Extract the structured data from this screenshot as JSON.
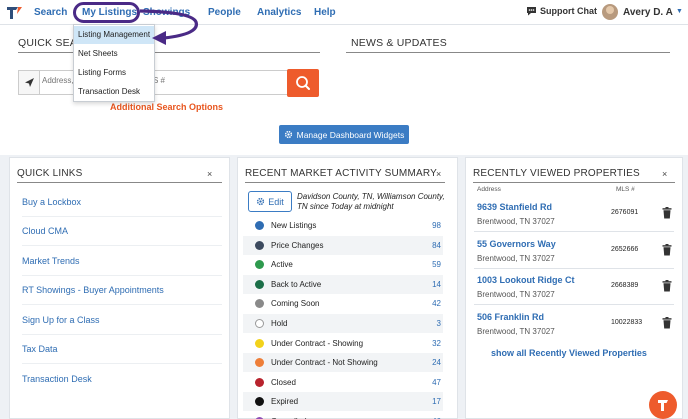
{
  "nav": {
    "items": [
      "Search",
      "My Listings",
      "Showings",
      "People",
      "Analytics",
      "Help"
    ],
    "support_chat": "Support Chat",
    "user_name": "Avery D. A"
  },
  "dropdown": {
    "items": [
      "Listing Management",
      "Net Sheets",
      "Listing Forms",
      "Transaction Desk"
    ],
    "active_index": 0
  },
  "quick_search": {
    "title": "QUICK SEA",
    "placeholder": "Address, City, Street, Zip or MLS #",
    "advanced_label": "Additional Search Options"
  },
  "news": {
    "title": "NEWS & UPDATES"
  },
  "manage_button": "Manage Dashboard Widgets",
  "quick_links": {
    "title": "QUICK LINKS",
    "close": "×",
    "items": [
      "Buy a Lockbox",
      "Cloud CMA",
      "Market Trends",
      "RT Showings - Buyer Appointments",
      "Sign Up for a Class",
      "Tax Data",
      "Transaction Desk"
    ]
  },
  "market_activity": {
    "title": "RECENT MARKET ACTIVITY SUMMARY",
    "close": "×",
    "edit_label": "Edit",
    "description": "Davidson County, TN, Williamson County, TN since Today at midnight",
    "rows": [
      {
        "label": "New Listings",
        "count": "98",
        "color": "#2f6db3"
      },
      {
        "label": "Price Changes",
        "count": "84",
        "color": "#3c4a5e"
      },
      {
        "label": "Active",
        "count": "59",
        "color": "#2e9a4e"
      },
      {
        "label": "Back to Active",
        "count": "14",
        "color": "#1b6e48"
      },
      {
        "label": "Coming Soon",
        "count": "42",
        "color": "#8a8a8a"
      },
      {
        "label": "Hold",
        "count": "3",
        "color": "#ffffff"
      },
      {
        "label": "Under Contract - Showing",
        "count": "32",
        "color": "#f2d21b"
      },
      {
        "label": "Under Contract - Not Showing",
        "count": "24",
        "color": "#ee7e38"
      },
      {
        "label": "Closed",
        "count": "47",
        "color": "#b8232d"
      },
      {
        "label": "Expired",
        "count": "17",
        "color": "#111111"
      },
      {
        "label": "Cancelled",
        "count": "46",
        "color": "#8e4fb6"
      }
    ]
  },
  "recent_viewed": {
    "title": "RECENTLY VIEWED PROPERTIES",
    "close": "×",
    "address_header": "Address",
    "mls_header": "MLS #",
    "items": [
      {
        "address": "9639 Stanfield Rd",
        "city": "Brentwood, TN 37027",
        "mls": "2676091"
      },
      {
        "address": "55 Governors Way",
        "city": "Brentwood, TN 37027",
        "mls": "2652666"
      },
      {
        "address": "1003 Lookout Ridge Ct",
        "city": "Brentwood, TN 37027",
        "mls": "2668389"
      },
      {
        "address": "506 Franklin Rd",
        "city": "Brentwood, TN 37027",
        "mls": "10022833"
      }
    ],
    "show_all": "show all Recently Viewed Properties"
  },
  "colors": {
    "accent": "#2f6db3",
    "brand_orange": "#ee5b2c",
    "annotation": "#4a2a86"
  }
}
